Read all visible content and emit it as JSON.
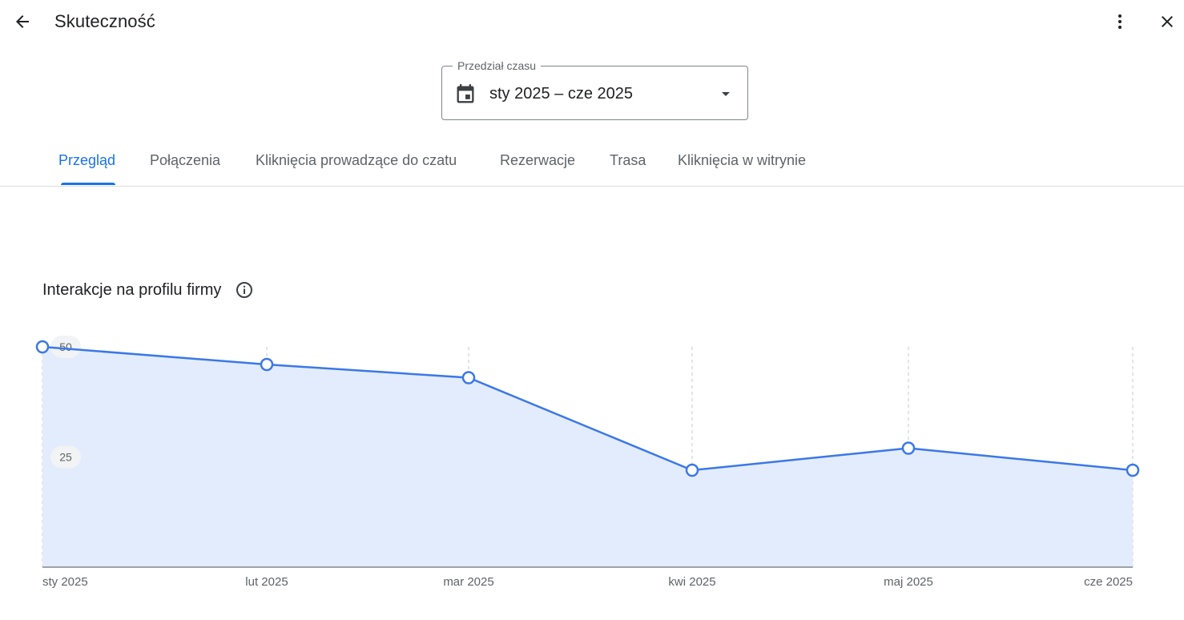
{
  "header": {
    "title": "Skuteczność",
    "back_icon": "arrow-back-icon",
    "more_icon": "more-vert-icon",
    "close_icon": "close-icon"
  },
  "date_range": {
    "label": "Przedział czasu",
    "value": "sty 2025 – cze 2025",
    "calendar_icon": "calendar-icon",
    "dropdown_icon": "arrow-drop-down-icon"
  },
  "tabs": [
    {
      "label": "Przegląd",
      "active": true
    },
    {
      "label": "Połączenia",
      "active": false
    },
    {
      "label": "Kliknięcia prowadzące do czatu",
      "active": false
    },
    {
      "label": "Rezerwacje",
      "active": false
    },
    {
      "label": "Trasa",
      "active": false
    },
    {
      "label": "Kliknięcia w witrynie",
      "active": false
    }
  ],
  "chart_section": {
    "title": "Interakcje na profilu firmy",
    "info_icon": "info-icon"
  },
  "colors": {
    "accent": "#1a73e8",
    "line": "#3b78e7",
    "area": "#e3ecfc"
  },
  "chart_data": {
    "type": "area",
    "categories": [
      "sty 2025",
      "lut 2025",
      "mar 2025",
      "kwi 2025",
      "maj 2025",
      "cze 2025"
    ],
    "series": [
      {
        "values": [
          50,
          46,
          43,
          22,
          27,
          22
        ]
      }
    ],
    "yticks": [
      50,
      25
    ],
    "ylim": [
      0,
      50
    ],
    "grid": "vertical-dashed",
    "legend": "none"
  }
}
